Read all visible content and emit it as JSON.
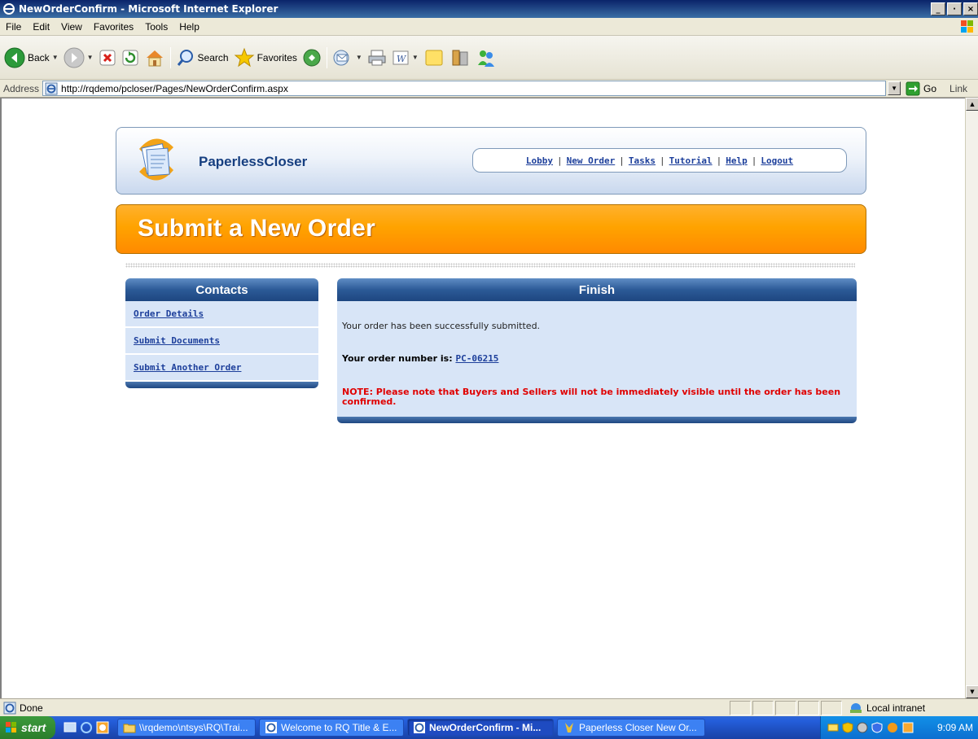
{
  "window": {
    "title": "NewOrderConfirm - Microsoft Internet Explorer",
    "controls": [
      "_",
      "·",
      "×"
    ]
  },
  "menu": [
    "File",
    "Edit",
    "View",
    "Favorites",
    "Tools",
    "Help"
  ],
  "toolbar": {
    "back_label": "Back",
    "search_label": "Search",
    "favorites_label": "Favorites"
  },
  "address": {
    "label": "Address",
    "url": "http://rqdemo/pcloser/Pages/NewOrderConfirm.aspx",
    "go_label": "Go",
    "links_label": "Link"
  },
  "page": {
    "brand": "PaperlessCloser",
    "nav": [
      "Lobby",
      "New Order",
      "Tasks",
      "Tutorial",
      "Help",
      "Logout"
    ],
    "banner_title": "Submit a New Order",
    "contacts": {
      "heading": "Contacts",
      "items": [
        "Order Details",
        "Submit Documents",
        "Submit Another Order"
      ]
    },
    "finish": {
      "heading": "Finish",
      "message": "Your order has been successfully submitted.",
      "order_label": "Your order number is:",
      "order_number": "PC-06215",
      "note": "NOTE: Please note that Buyers and Sellers will not be immediately visible until the order has been confirmed."
    }
  },
  "status": {
    "text": "Done",
    "zone": "Local intranet"
  },
  "taskbar": {
    "start_label": "start",
    "tasks": [
      {
        "label": "\\\\rqdemo\\ntsys\\RQ\\Trai...",
        "active": false
      },
      {
        "label": "Welcome to RQ Title & E...",
        "active": false
      },
      {
        "label": "NewOrderConfirm - Mi...",
        "active": true
      },
      {
        "label": "Paperless Closer New Or...",
        "active": false
      }
    ],
    "clock": "9:09 AM"
  },
  "colors": {
    "accent_blue": "#2c5a97",
    "banner_orange": "#ffa300",
    "link_blue": "#1d3f9b",
    "note_red": "#e00000",
    "panel_bg": "#d8e5f7"
  }
}
